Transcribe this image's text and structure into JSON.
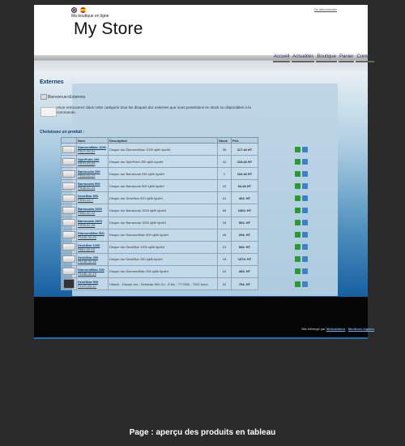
{
  "header": {
    "tagline": "Ma boutique en ligne",
    "title": "My Store",
    "logout": "Se déconnecter",
    "flags": [
      "english-flag-icon",
      "spanish-flag-icon"
    ]
  },
  "nav": {
    "items": [
      "Accueil",
      "Actualités",
      "Boutique",
      "Panier",
      "Contact"
    ]
  },
  "category": {
    "title": "Externes",
    "breadcrumb": "Bienvenue>Externes",
    "intro": "Vous retrouverez dans cette catégorie tous les disques dur externes que nous possédons en stock ou disponibles à la commande."
  },
  "products": {
    "heading": "Choisissez un produit :",
    "columns": [
      "",
      "Nom",
      "Description",
      "Stock",
      "Prix"
    ],
    "rows": [
      {
        "name": "DiamondMax 1000",
        "ref": "PS27-02-21",
        "desc": "Disque dur DiamondMax 1000 sjkfh kjcdhf",
        "stock": "39",
        "price": "117.44 HT"
      },
      {
        "name": "SpinPoint 250",
        "ref": "PS70-03-03",
        "desc": "Disque dur SpinPoint 250 sjkfh kjcdhf",
        "stock": "41",
        "price": "115.44 HT"
      },
      {
        "name": "Barracuda 250",
        "ref": "PS43-02-23",
        "desc": "Disque dur Barracuda 250 sjkfh kjcdhf",
        "stock": "1",
        "price": "110.44 HT"
      },
      {
        "name": "Barracuda 500",
        "ref": "PS38-02-24",
        "desc": "Disque dur Barracuda 500 sjkfh kjcdhf",
        "stock": "10",
        "price": "64.44 HT"
      },
      {
        "name": "DeskStar 500",
        "ref": "PS90-02-?",
        "desc": "Disque dur DeskStar 500 sjkfh kjcdhf",
        "stock": "41",
        "price": "404. HT"
      },
      {
        "name": "Barracuda 1000",
        "ref": "PS62-02-12",
        "desc": "Disque dur Barracuda 1000 sjkfh kjcdhf",
        "stock": "50",
        "price": "1404. HT"
      },
      {
        "name": "Barracuda 1500",
        "ref": "PS99-02-25",
        "desc": "Disque dur Barracuda 1500 sjkfh kjcdhf",
        "stock": "15",
        "price": "504. HT"
      },
      {
        "name": "DiamondMax 500",
        "ref": "P1100-02-20",
        "desc": "Disque dur DiamondMax 500 sjkfh kjcdhf",
        "stock": "26",
        "price": "294. HT"
      },
      {
        "name": "DeskStar 1000",
        "ref": "P801-02-15",
        "desc": "Disque dur DeskStar 1000 sjkfh kjcdhf",
        "stock": "21",
        "price": "544. HT"
      },
      {
        "name": "DeskStar 250",
        "ref": "P1140-02-16",
        "desc": "Disque dur DeskStar 250 sjkfh kjcdhf",
        "stock": "19",
        "price": "1374. HT"
      },
      {
        "name": "DiamondMax 250",
        "ref": "P1180-02-19",
        "desc": "Disque dur DiamondMax 250 sjkfh kjcdhf",
        "stock": "12",
        "price": "494. HT"
      },
      {
        "name": "DeskStar 500",
        "ref": "P1470-02-17",
        "desc": "Hitachi - Disque dur - Deskstar 500 Go - 8 Mo - 7??/500 - 7200 tours",
        "stock": "22",
        "price": "794. HT"
      }
    ]
  },
  "footer": {
    "prefix": "Site hébergé par",
    "host": "Webcalibers",
    "separator": " - ",
    "legal": "Mentions légales"
  },
  "caption": "Page : aperçu des produits en tableau",
  "colors": {
    "accent": "#1660a2",
    "nav_text": "#1c3b66",
    "title": "#0d3d6b"
  }
}
